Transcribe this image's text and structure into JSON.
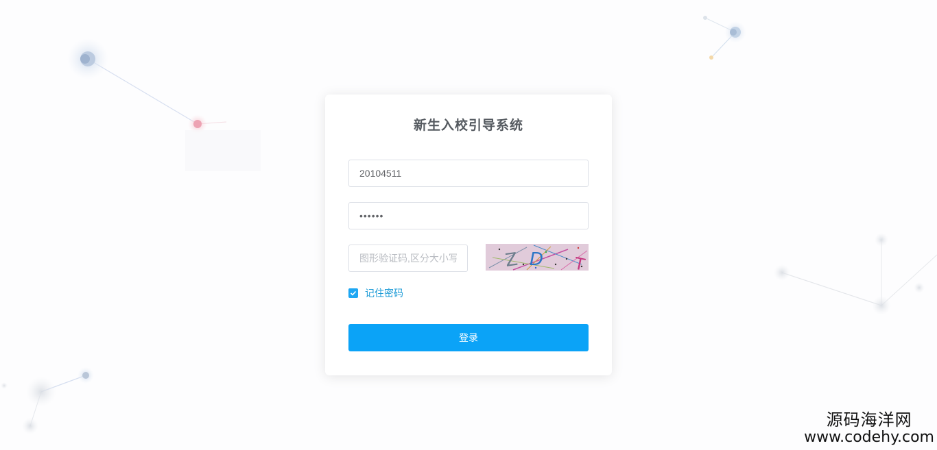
{
  "login": {
    "title": "新生入校引导系统",
    "username_value": "20104511",
    "password_value": "••••••",
    "captcha_placeholder": "图形验证码,区分大小写",
    "remember_label": "记住密码",
    "remember_checked": true,
    "login_label": "登录"
  },
  "captcha": {
    "characters": [
      "Z",
      "D",
      "T"
    ]
  },
  "watermark": {
    "cn": "源码海洋网",
    "url": "www.codehy.com"
  },
  "colors": {
    "primary": "#0ba3f7",
    "checkbox": "#1ea7f3",
    "title": "#555a60"
  }
}
